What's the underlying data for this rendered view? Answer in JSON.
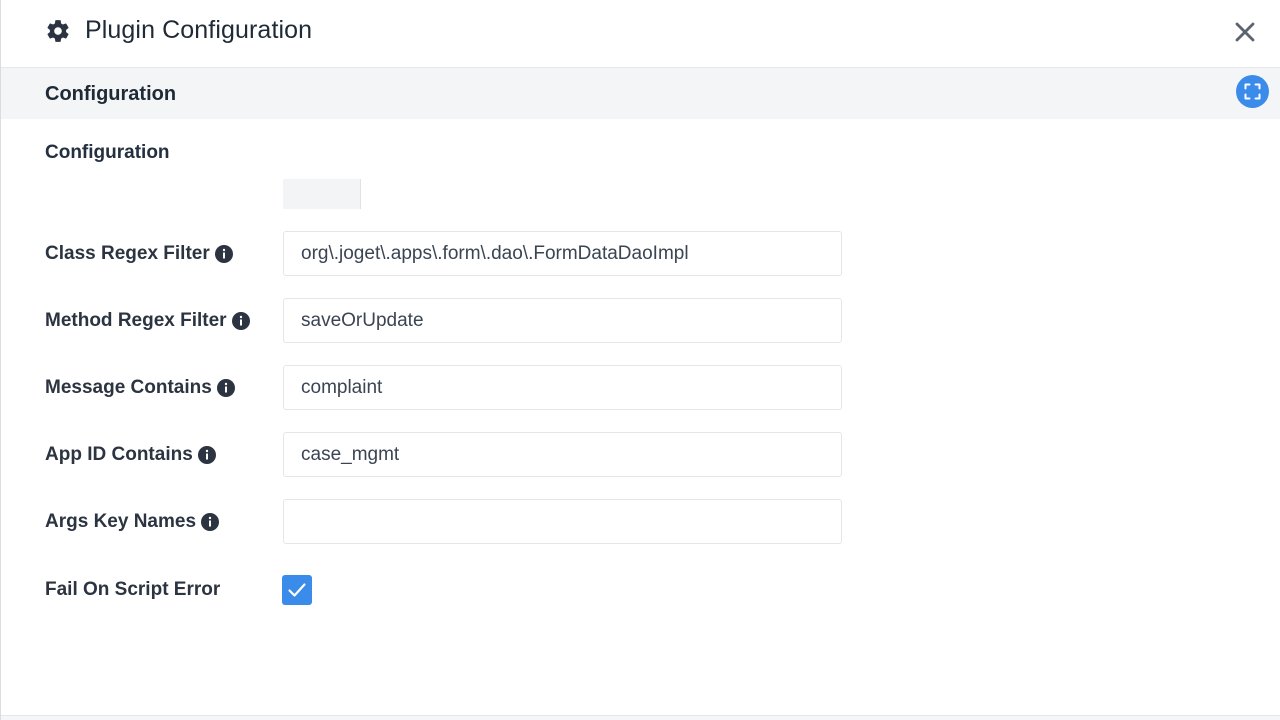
{
  "header": {
    "title": "Plugin Configuration",
    "icon": "gear-icon",
    "close_icon": "close-icon"
  },
  "section": {
    "title": "Configuration",
    "expand_icon": "fullscreen-icon"
  },
  "form": {
    "subheading": "Configuration",
    "fields": [
      {
        "label": "Class Regex Filter",
        "value": "org\\.joget\\.apps\\.form\\.dao\\.FormDataDaoImpl"
      },
      {
        "label": "Method Regex Filter",
        "value": "saveOrUpdate"
      },
      {
        "label": "Message Contains",
        "value": "complaint"
      },
      {
        "label": "App ID Contains",
        "value": "case_mgmt"
      },
      {
        "label": "Args Key Names",
        "value": ""
      }
    ],
    "checkbox": {
      "label": "Fail On Script Error",
      "checked": true
    }
  },
  "colors": {
    "accent": "#3b8beb",
    "text": "#2b3440",
    "section_bg": "#f4f5f6"
  }
}
